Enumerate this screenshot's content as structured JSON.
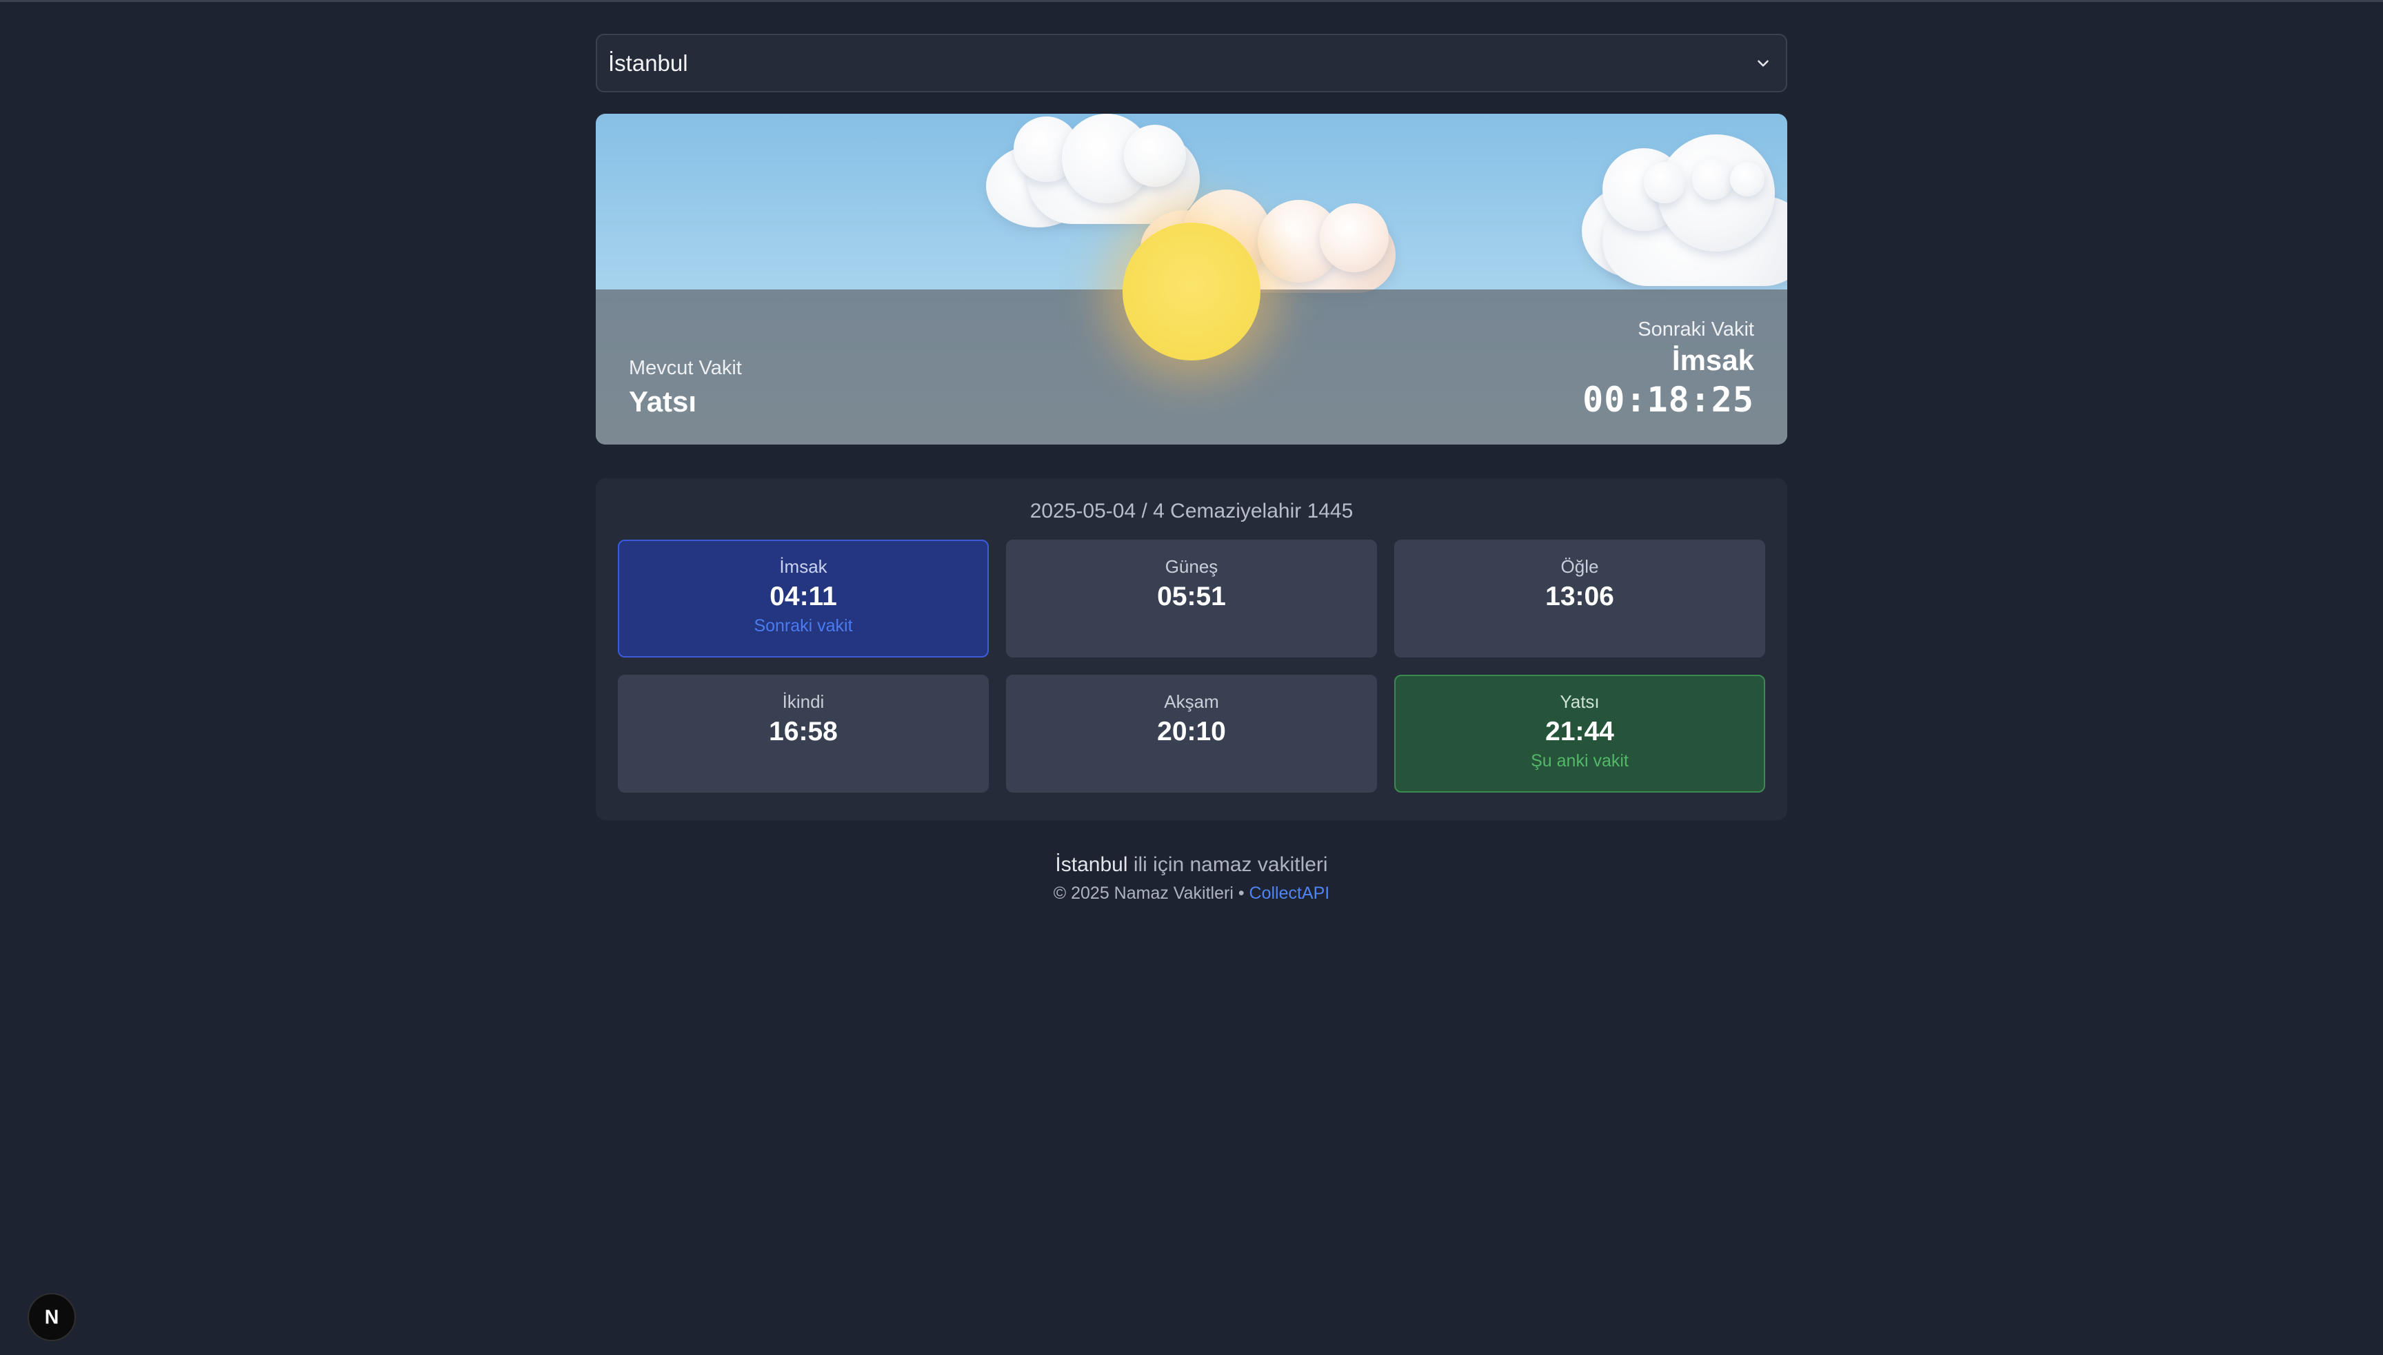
{
  "city_select": {
    "value": "İstanbul",
    "icon": "chevron-down-icon"
  },
  "hero": {
    "current_label": "Mevcut Vakit",
    "current_name": "Yatsı",
    "next_label": "Sonraki Vakit",
    "next_name": "İmsak",
    "countdown": "00:18:25"
  },
  "prayer_panel": {
    "date_line": "2025-05-04 / 4 Cemaziyelahir 1445",
    "cards": [
      {
        "name": "İmsak",
        "time": "04:11",
        "sub": "Sonraki vakit",
        "state": "next"
      },
      {
        "name": "Güneş",
        "time": "05:51",
        "sub": "",
        "state": "normal"
      },
      {
        "name": "Öğle",
        "time": "13:06",
        "sub": "",
        "state": "normal"
      },
      {
        "name": "İkindi",
        "time": "16:58",
        "sub": "",
        "state": "normal"
      },
      {
        "name": "Akşam",
        "time": "20:10",
        "sub": "",
        "state": "normal"
      },
      {
        "name": "Yatsı",
        "time": "21:44",
        "sub": "Şu anki vakit",
        "state": "current"
      }
    ]
  },
  "footer": {
    "city": "İstanbul",
    "text_suffix": " ili için namaz vakitleri",
    "copyright": "© 2025 Namaz Vakitleri • ",
    "link_label": "CollectAPI"
  },
  "dev_badge": {
    "letter": "N",
    "icon": "nextjs-logo-icon"
  },
  "colors": {
    "background": "#1e2331",
    "panel": "#252b38",
    "card": "#384051",
    "next_card": "#24367f",
    "next_accent": "#4b7bf0",
    "current_card": "#25543a",
    "current_accent": "#54b76a",
    "link": "#4f84f4"
  }
}
